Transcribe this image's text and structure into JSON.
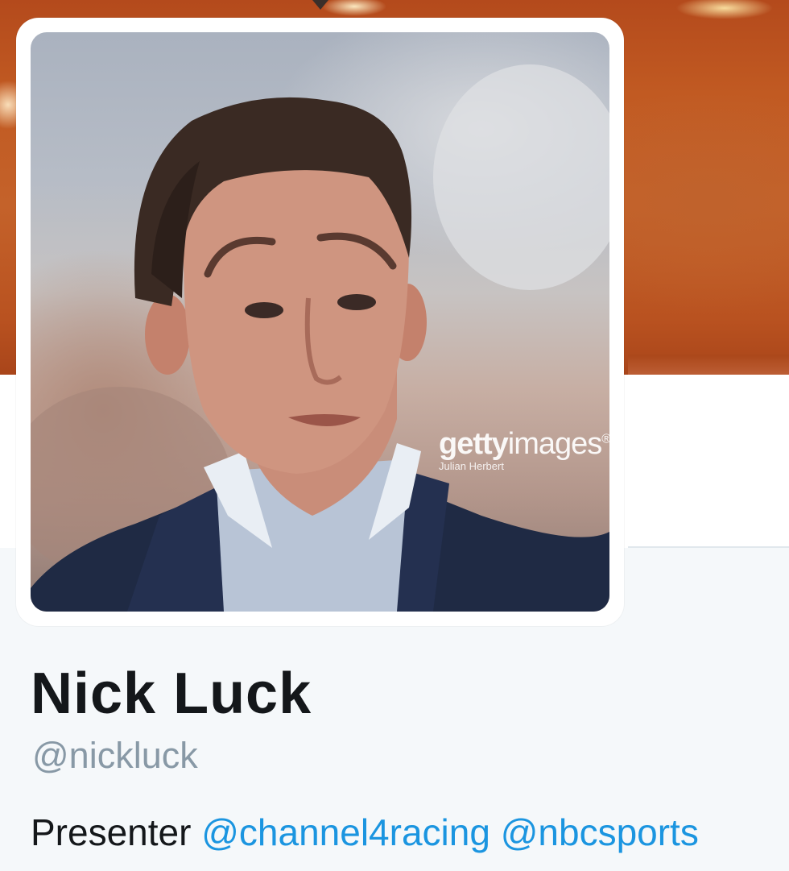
{
  "profile": {
    "name": "Nick Luck",
    "handle": "@nickluck",
    "bio_text": "Presenter",
    "bio_links": [
      "@channel4racing",
      "@nbcsports"
    ]
  },
  "avatar": {
    "watermark_brand_bold": "getty",
    "watermark_brand_regular": "images",
    "watermark_mark": "®",
    "watermark_credit": "Julian Herbert"
  },
  "colors": {
    "link": "#1b95e0",
    "name": "#14171a",
    "handle": "#8899a6",
    "banner": "#c15a22"
  }
}
